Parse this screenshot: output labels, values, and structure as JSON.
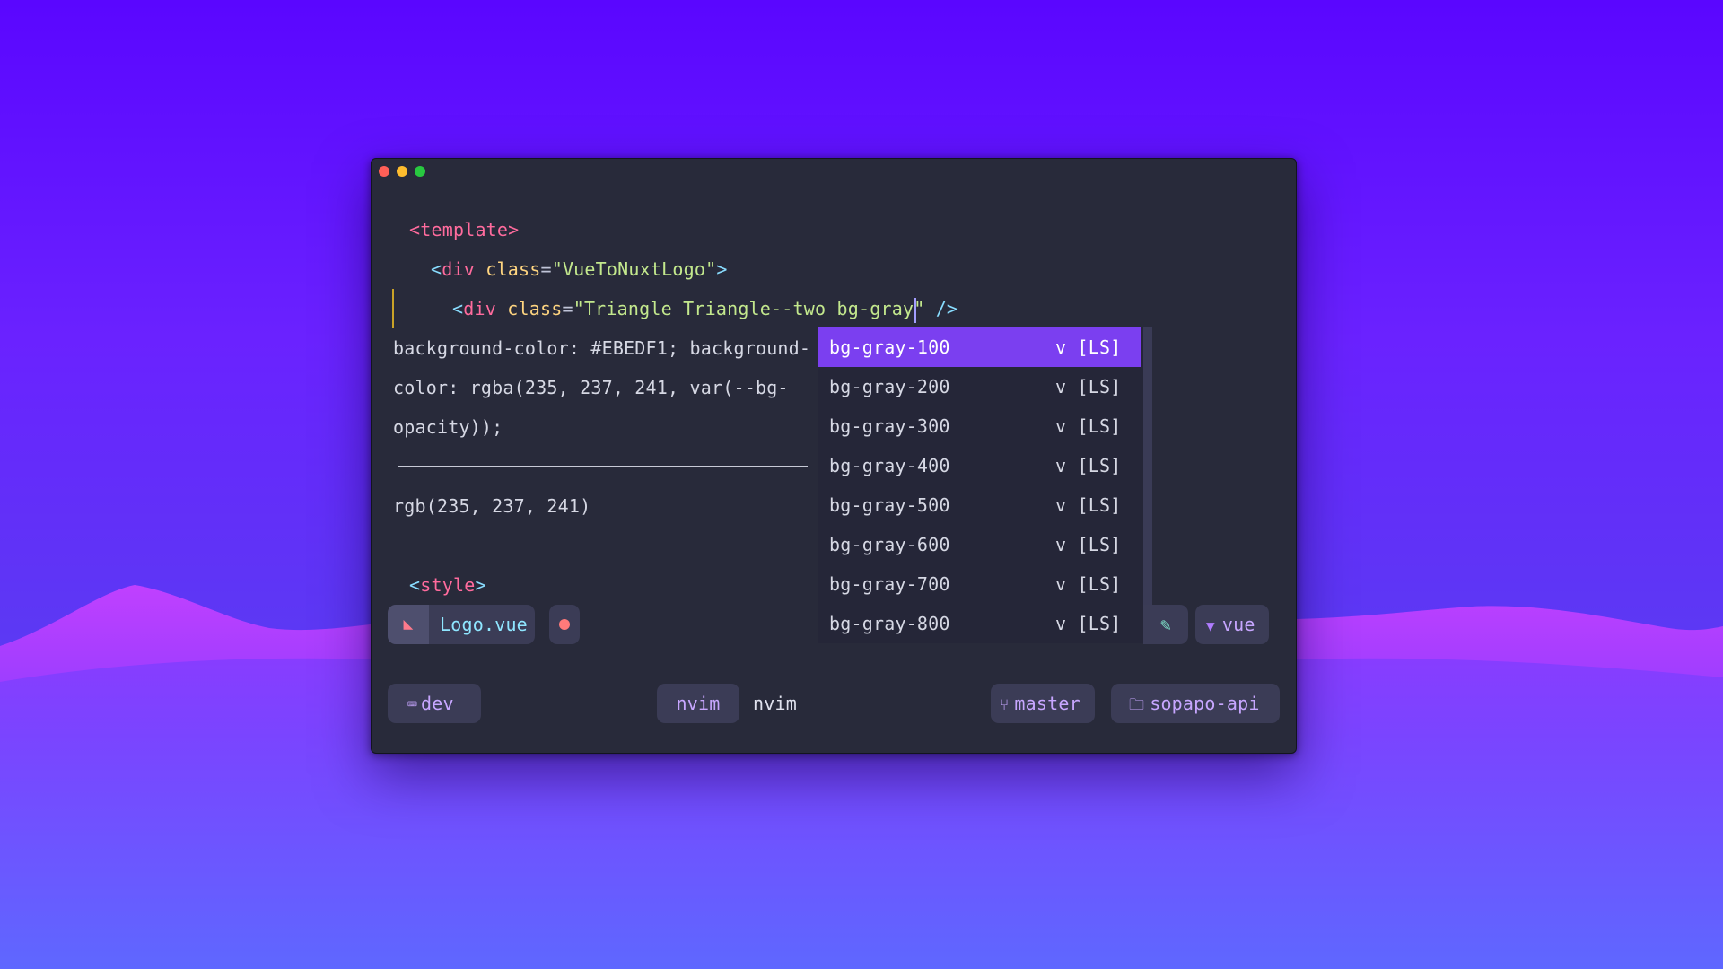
{
  "editor": {
    "lines": {
      "template_open": "<template>",
      "div_open_tag": "div",
      "div_attr": "class",
      "div_class": "\"VueToNuxtLogo\"",
      "inner_tag": "div",
      "inner_attr": "class",
      "inner_class_before_cursor": "\"Triangle Triangle--two bg-gray",
      "inner_class_after_cursor": "\"",
      "self_close": "/>",
      "style_open": "<style>"
    },
    "doc": {
      "line1": "background-color: #EBEDF1; background-",
      "line2": "color: rgba(235, 237, 241, var(--bg-",
      "line3": "opacity));",
      "line4": "rgb(235, 237, 241)"
    }
  },
  "completion": {
    "items": [
      {
        "label": "bg-gray-100",
        "kind": "v [LS]",
        "selected": true
      },
      {
        "label": "bg-gray-200",
        "kind": "v [LS]"
      },
      {
        "label": "bg-gray-300",
        "kind": "v [LS]"
      },
      {
        "label": "bg-gray-400",
        "kind": "v [LS]"
      },
      {
        "label": "bg-gray-500",
        "kind": "v [LS]"
      },
      {
        "label": "bg-gray-600",
        "kind": "v [LS]"
      },
      {
        "label": "bg-gray-700",
        "kind": "v [LS]"
      },
      {
        "label": "bg-gray-800",
        "kind": "v [LS]"
      }
    ]
  },
  "statusline": {
    "filename": "Logo.vue",
    "filetype": "vue",
    "modified_color": "#ff7a7a"
  },
  "tmux": {
    "session": "dev",
    "window_name": "nvim",
    "window_title": "nvim",
    "branch": "master",
    "folder": "sopapo-api"
  },
  "colors": {
    "selection": "#7b3ff0",
    "tag": "#ff6b9d",
    "attr": "#ffd580",
    "string": "#c3e88d"
  }
}
